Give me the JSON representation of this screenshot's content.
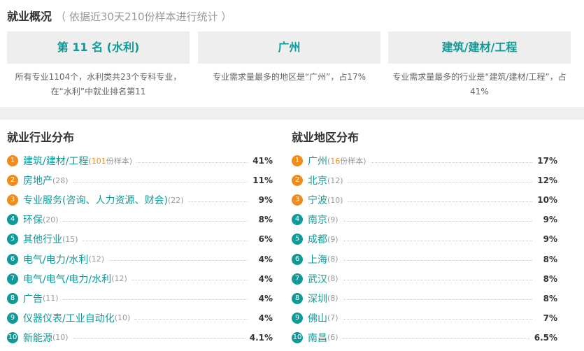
{
  "header": {
    "title": "就业概况",
    "note": "（ 依据近30天210份样本进行统计 ）"
  },
  "cards": [
    {
      "value": "第 11 名 (水利)",
      "desc": "所有专业1104个，水利类共23个专科专业，在“水利”中就业排名第11"
    },
    {
      "value": "广州",
      "desc": "专业需求量最多的地区是“广州”，占17%"
    },
    {
      "value": "建筑/建材/工程",
      "desc": "专业需求量最多的行业是“建筑/建材/工程”，占41%"
    }
  ],
  "industry": {
    "title": "就业行业分布",
    "items": [
      {
        "rank": "1",
        "name": "建筑/建材/工程",
        "count_pre": "(",
        "count": "101",
        "count_post": "份样本)",
        "pct": "41%"
      },
      {
        "rank": "2",
        "name": "房地产",
        "count_pre": "(",
        "count": "28",
        "count_post": ")",
        "pct": "11%"
      },
      {
        "rank": "3",
        "name": "专业服务(咨询、人力资源、财会)",
        "count_pre": "(",
        "count": "22",
        "count_post": ")",
        "pct": "9%"
      },
      {
        "rank": "4",
        "name": "环保",
        "count_pre": "(",
        "count": "20",
        "count_post": ")",
        "pct": "8%"
      },
      {
        "rank": "5",
        "name": "其他行业",
        "count_pre": "(",
        "count": "15",
        "count_post": ")",
        "pct": "6%"
      },
      {
        "rank": "6",
        "name": "电气/电力/水利",
        "count_pre": "(",
        "count": "12",
        "count_post": ")",
        "pct": "4%"
      },
      {
        "rank": "7",
        "name": "电气/电气/电力/水利",
        "count_pre": "(",
        "count": "12",
        "count_post": ")",
        "pct": "4%"
      },
      {
        "rank": "8",
        "name": "广告",
        "count_pre": "(",
        "count": "11",
        "count_post": ")",
        "pct": "4%"
      },
      {
        "rank": "9",
        "name": "仪器仪表/工业自动化",
        "count_pre": "(",
        "count": "10",
        "count_post": ")",
        "pct": "4%"
      },
      {
        "rank": "10",
        "name": "新能源",
        "count_pre": "(",
        "count": "10",
        "count_post": ")",
        "pct": "4.1%"
      }
    ]
  },
  "region": {
    "title": "就业地区分布",
    "items": [
      {
        "rank": "1",
        "name": "广州",
        "count_pre": "(",
        "count": "16",
        "count_post": "份样本)",
        "pct": "17%"
      },
      {
        "rank": "2",
        "name": "北京",
        "count_pre": "(",
        "count": "12",
        "count_post": ")",
        "pct": "12%"
      },
      {
        "rank": "3",
        "name": "宁波",
        "count_pre": "(",
        "count": "10",
        "count_post": ")",
        "pct": "10%"
      },
      {
        "rank": "4",
        "name": "南京",
        "count_pre": "(",
        "count": "9",
        "count_post": ")",
        "pct": "9%"
      },
      {
        "rank": "5",
        "name": "成都",
        "count_pre": "(",
        "count": "9",
        "count_post": ")",
        "pct": "9%"
      },
      {
        "rank": "6",
        "name": "上海",
        "count_pre": "(",
        "count": "8",
        "count_post": ")",
        "pct": "8%"
      },
      {
        "rank": "7",
        "name": "武汉",
        "count_pre": "(",
        "count": "8",
        "count_post": ")",
        "pct": "8%"
      },
      {
        "rank": "8",
        "name": "深圳",
        "count_pre": "(",
        "count": "8",
        "count_post": ")",
        "pct": "8%"
      },
      {
        "rank": "9",
        "name": "佛山",
        "count_pre": "(",
        "count": "7",
        "count_post": ")",
        "pct": "7%"
      },
      {
        "rank": "10",
        "name": "南昌",
        "count_pre": "(",
        "count": "6",
        "count_post": ")",
        "pct": "6.5%"
      }
    ]
  }
}
